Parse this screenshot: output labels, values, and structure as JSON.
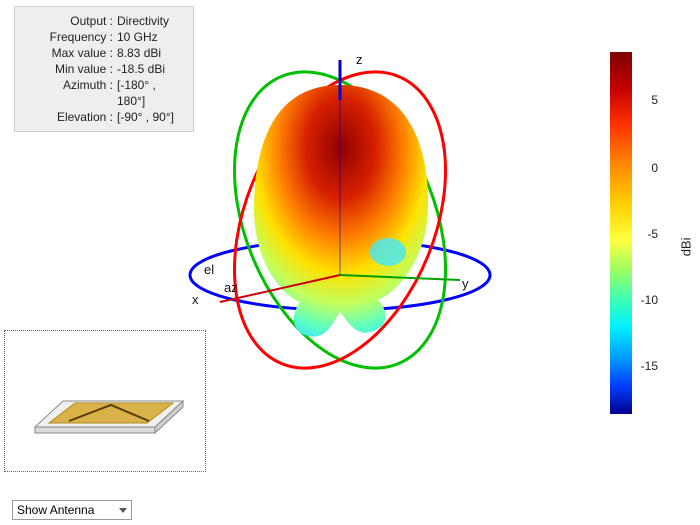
{
  "info": {
    "output_label": "Output :",
    "output_value": "Directivity",
    "frequency_label": "Frequency :",
    "frequency_value": "10 GHz",
    "max_label": "Max value :",
    "max_value": "8.83 dBi",
    "min_label": "Min value :",
    "min_value": "-18.5 dBi",
    "azimuth_label": "Azimuth :",
    "azimuth_value": "[-180° , 180°]",
    "elevation_label": "Elevation :",
    "elevation_value": "[-90° , 90°]"
  },
  "axes": {
    "x": "x",
    "y": "y",
    "z": "z",
    "az": "az",
    "el": "el"
  },
  "colorbar": {
    "title": "dBi",
    "ticks": [
      "5",
      "0",
      "-5",
      "-10",
      "-15"
    ],
    "range_max": 8.83,
    "range_min": -18.5
  },
  "dropdown": {
    "selected": "Show Antenna"
  },
  "chart_data": {
    "type": "3d-radiation-pattern",
    "title": "Directivity",
    "frequency_ghz": 10,
    "max_dbi": 8.83,
    "min_dbi": -18.5,
    "azimuth_range_deg": [
      -180,
      180
    ],
    "elevation_range_deg": [
      -90,
      90
    ],
    "colorbar_unit": "dBi",
    "colorbar_ticks": [
      5,
      0,
      -5,
      -10,
      -15
    ],
    "principal_rings": [
      "x-y plane (blue)",
      "x-z plane (green)",
      "y-z plane (red)"
    ],
    "notes": "Broadside lobe along +z near 8.8 dBi; backlobe / nulls below 0° elevation down to roughly -18.5 dBi."
  }
}
